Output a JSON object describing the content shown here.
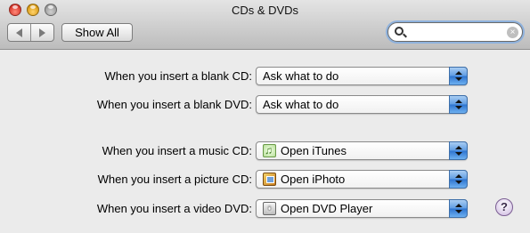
{
  "window": {
    "title": "CDs & DVDs"
  },
  "toolbar": {
    "show_all_label": "Show All",
    "search": {
      "value": "",
      "placeholder": ""
    }
  },
  "rows": [
    {
      "label": "When you insert a blank CD:",
      "value": "Ask what to do",
      "icon": null
    },
    {
      "label": "When you insert a blank DVD:",
      "value": "Ask what to do",
      "icon": null
    },
    {
      "label": "When you insert a music CD:",
      "value": "Open iTunes",
      "icon": "itunes-icon"
    },
    {
      "label": "When you insert a picture CD:",
      "value": "Open iPhoto",
      "icon": "iphoto-icon"
    },
    {
      "label": "When you insert a video DVD:",
      "value": "Open DVD Player",
      "icon": "dvd-player-icon"
    }
  ],
  "help": {
    "label": "?"
  }
}
